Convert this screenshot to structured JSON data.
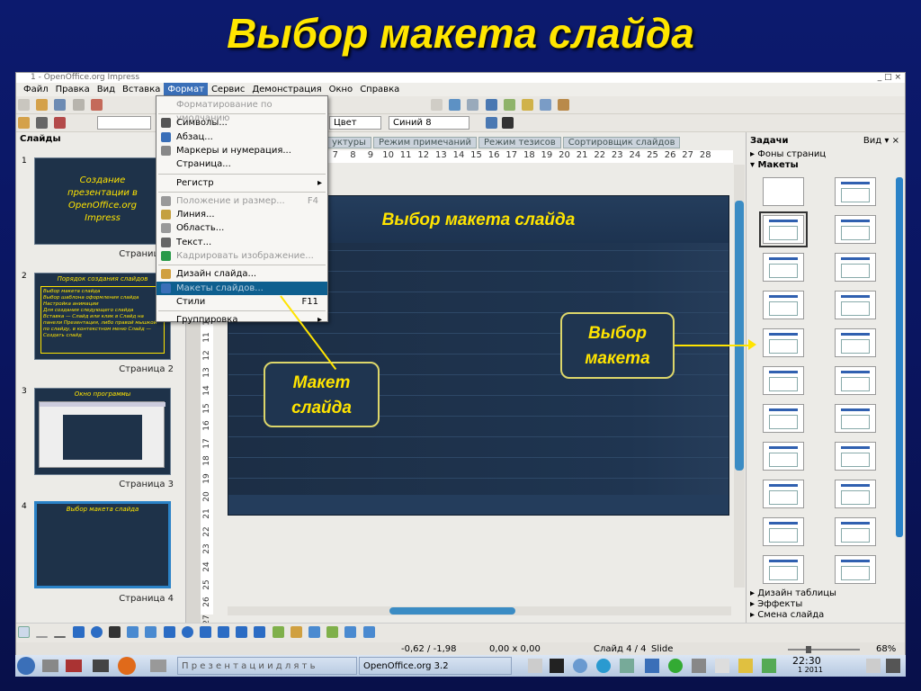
{
  "page_title": "Выбор макета слайда",
  "window": {
    "title": "1 - OpenOffice.org Impress",
    "controls": "_ □ ×"
  },
  "menubar": [
    "Файл",
    "Правка",
    "Вид",
    "Вставка",
    "Формат",
    "Сервис",
    "Демонстрация",
    "Окно",
    "Справка"
  ],
  "toolbar2": {
    "color_mode": "Цвет",
    "line_color": "Синий 8"
  },
  "slides_panel": {
    "header": "Слайды",
    "slides": [
      {
        "num": "1",
        "title": "Создание презентации в OpenOffice.org Impress",
        "caption": "Страница 1"
      },
      {
        "num": "2",
        "title": "Порядок создания слайдов",
        "caption": "Страница 2",
        "bullets": [
          "Выбор макета слайда",
          "Выбор шаблона оформления слайда",
          "Настройка анимации",
          "Для создания следующего слайда",
          "Вставка — Слайд или клик в Слайд на панели Презентация, либо правой мышкой по слайду, в контекстном меню Слайд — Создать слайд"
        ]
      },
      {
        "num": "3",
        "title": "Окно программы",
        "caption": "Страница 3"
      },
      {
        "num": "4",
        "title": "Выбор макета слайда",
        "caption": "Страница 4"
      }
    ]
  },
  "view_tabs": [
    "уктуры",
    "Режим примечаний",
    "Режим тезисов",
    "Сортировщик слайдов"
  ],
  "ruler_marks": [
    "7",
    "8",
    "9",
    "10",
    "11",
    "12",
    "13",
    "14",
    "15",
    "16",
    "17",
    "18",
    "19",
    "20",
    "21",
    "22",
    "23",
    "24",
    "25",
    "26",
    "27",
    "28"
  ],
  "vruler_marks": [
    "9",
    "10",
    "11",
    "12",
    "13",
    "14",
    "15",
    "16",
    "17",
    "18",
    "19",
    "20",
    "21",
    "22",
    "23",
    "24",
    "25",
    "26",
    "27"
  ],
  "slide": {
    "title": "Выбор макета слайда"
  },
  "callouts": {
    "layout": "Макет слайда",
    "choose": "Выбор макета"
  },
  "format_menu": [
    {
      "label": "Форматирование по умолчанию",
      "disabled": true
    },
    {
      "sep": true
    },
    {
      "label": "Символы...",
      "icon": "font-icon"
    },
    {
      "label": "Абзац...",
      "icon": "paragraph-icon"
    },
    {
      "label": "Маркеры и нумерация...",
      "icon": "bullets-icon"
    },
    {
      "label": "Страница..."
    },
    {
      "sep": true
    },
    {
      "label": "Регистр",
      "submenu": true
    },
    {
      "sep": true
    },
    {
      "label": "Положение и размер...",
      "shortcut": "F4",
      "disabled": true,
      "icon": "position-icon"
    },
    {
      "label": "Линия...",
      "icon": "line-icon"
    },
    {
      "label": "Область...",
      "icon": "area-icon"
    },
    {
      "label": "Текст...",
      "icon": "text-icon"
    },
    {
      "label": "Кадрировать изображение...",
      "disabled": true,
      "icon": "crop-icon"
    },
    {
      "sep": true
    },
    {
      "label": "Дизайн слайда...",
      "icon": "design-icon"
    },
    {
      "label": "Макеты слайдов...",
      "highlight": true,
      "icon": "layouts-icon"
    },
    {
      "label": "Стили",
      "shortcut": "F11"
    },
    {
      "sep": true
    },
    {
      "label": "Группировка",
      "submenu": true
    }
  ],
  "tasks": {
    "header": "Задачи",
    "view": "Вид",
    "backgrounds": "Фоны страниц",
    "layouts": "Макеты",
    "table_design": "Дизайн таблицы",
    "effects": "Эффекты",
    "transition": "Смена слайда"
  },
  "status": {
    "pos": "-0,62 / -1,98",
    "size": "0,00 x 0,00",
    "slide": "Слайд 4 / 4",
    "layout": "Slide",
    "zoom": "68%"
  },
  "taskbar": {
    "item1": "П р е з е н т а ц и и  д л я  т ь",
    "item2": "OpenOffice.org 3.2",
    "time": "22:30",
    "date": "1 2011"
  },
  "colors": {
    "title": "#ffe600",
    "accent": "#3b8cc4",
    "menu_hl": "#0e5f8f"
  }
}
